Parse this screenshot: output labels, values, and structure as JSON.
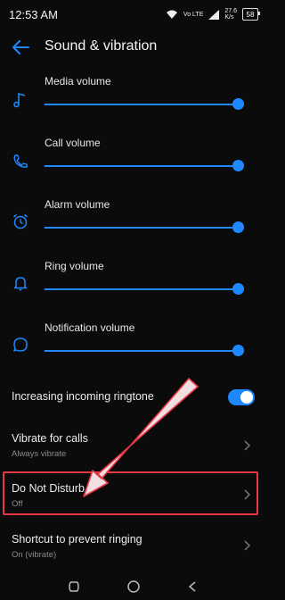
{
  "status": {
    "time": "12:53 AM",
    "net_top": "Vo LTE",
    "speed_top": "27.6",
    "speed_unit": "K/s",
    "battery": "58"
  },
  "header": {
    "title": "Sound & vibration"
  },
  "volumes": [
    {
      "label": "Media volume",
      "icon": "music-note-icon",
      "level": 1.0
    },
    {
      "label": "Call volume",
      "icon": "phone-icon",
      "level": 1.0
    },
    {
      "label": "Alarm volume",
      "icon": "alarm-clock-icon",
      "level": 1.0
    },
    {
      "label": "Ring volume",
      "icon": "bell-icon",
      "level": 1.0
    },
    {
      "label": "Notification volume",
      "icon": "chat-bubble-icon",
      "level": 1.0
    }
  ],
  "settings": {
    "increasing_ringtone": {
      "label": "Increasing incoming ringtone",
      "enabled": true
    },
    "vibrate_calls": {
      "label": "Vibrate for calls",
      "value": "Always vibrate"
    },
    "dnd": {
      "label": "Do Not Disturb",
      "value": "Off"
    },
    "shortcut": {
      "label": "Shortcut to prevent ringing",
      "value": "On (vibrate)"
    }
  },
  "colors": {
    "accent": "#1e88ff",
    "highlight": "#e63946",
    "background": "#0b0b0b"
  }
}
